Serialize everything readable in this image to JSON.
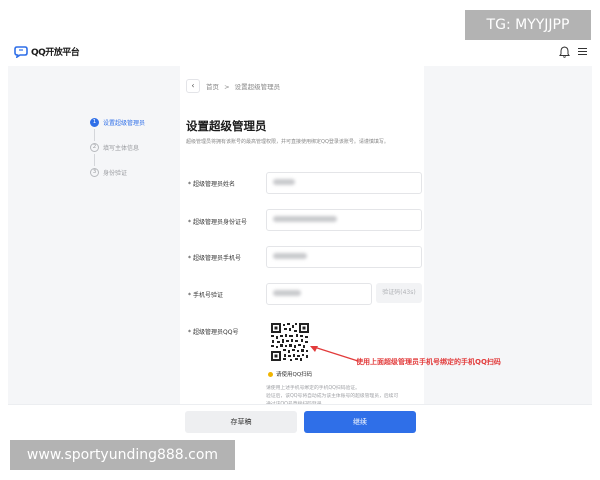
{
  "header": {
    "logo_text": "QQ开放平台",
    "logo_icon": "qq-logo-icon",
    "bell_icon": "bell-icon",
    "menu_icon": "menu-icon"
  },
  "breadcrumb": {
    "back_icon": "chevron-left-icon",
    "home": "首页",
    "separator": ">",
    "current": "设置超级管理员"
  },
  "steps": [
    {
      "number": "1",
      "label": "设置超级管理员",
      "state": "active"
    },
    {
      "number": "2",
      "label": "填写主体信息",
      "state": "inactive"
    },
    {
      "number": "3",
      "label": "身份验证",
      "state": "inactive"
    }
  ],
  "page": {
    "title": "设置超级管理员",
    "description": "超级管理员将拥有该账号的最高管理权限，并可直接使用绑定QQ登录该账号。请谨慎填写。"
  },
  "form": {
    "name_label": "超级管理员姓名",
    "id_label": "超级管理员身份证号",
    "phone_label": "超级管理员手机号",
    "verify_label": "手机号验证",
    "code_button": "验证码(43s)",
    "qq_label": "超级管理员QQ号",
    "required_mark": "*",
    "qr_hint": "请使用QQ扫码",
    "qr_notes": [
      "请使用上述手机号绑定的手机QQ扫码验证。",
      "验证后，该QQ号将自动成为该主体账号的超级管理员，后续可",
      "通过该QQ号直接扫码登录。"
    ]
  },
  "annotation": "使用上面超级管理员手机号绑定的手机QQ扫码",
  "footer": {
    "draft_button": "存草稿",
    "next_button": "继续"
  },
  "watermarks": {
    "tg": "TG: MYYJJPP",
    "url": "www.sportyunding888.com"
  },
  "colors": {
    "accent": "#2f6fe8",
    "annotation": "#e23b3b",
    "step_active": "#2f6fe8"
  }
}
